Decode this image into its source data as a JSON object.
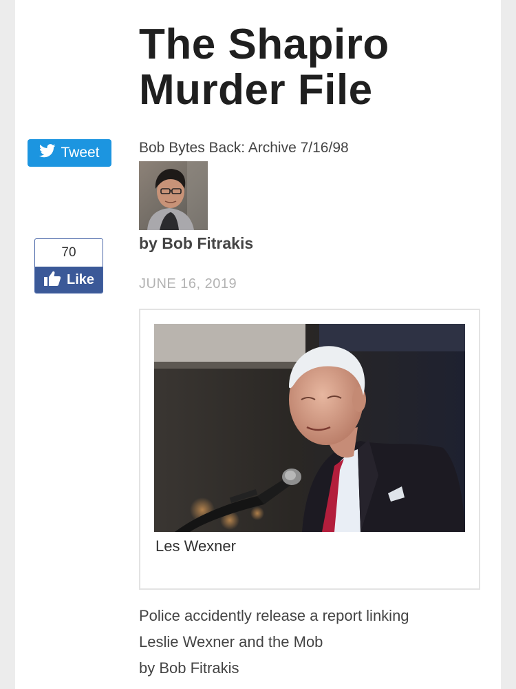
{
  "article": {
    "title_line1": "The Shapiro",
    "title_line2": "Murder File",
    "subtitle": "Bob Bytes Back: Archive 7/16/98",
    "byline": "by Bob Fitrakis",
    "date": "JUNE 16, 2019"
  },
  "social": {
    "tweet_label": "Tweet",
    "like_count": "70",
    "like_label": "Like"
  },
  "figure": {
    "caption": "Les Wexner"
  },
  "body": {
    "line1": "Police accidently release a report linking",
    "line2": "Leslie Wexner and the Mob",
    "line3": "by Bob Fitrakis"
  },
  "colors": {
    "twitter_blue": "#1c95e0",
    "facebook_blue": "#3b5998",
    "page_background": "#ececec"
  },
  "icons": {
    "tweet": "twitter-bird-icon",
    "like": "thumbs-up-icon"
  }
}
